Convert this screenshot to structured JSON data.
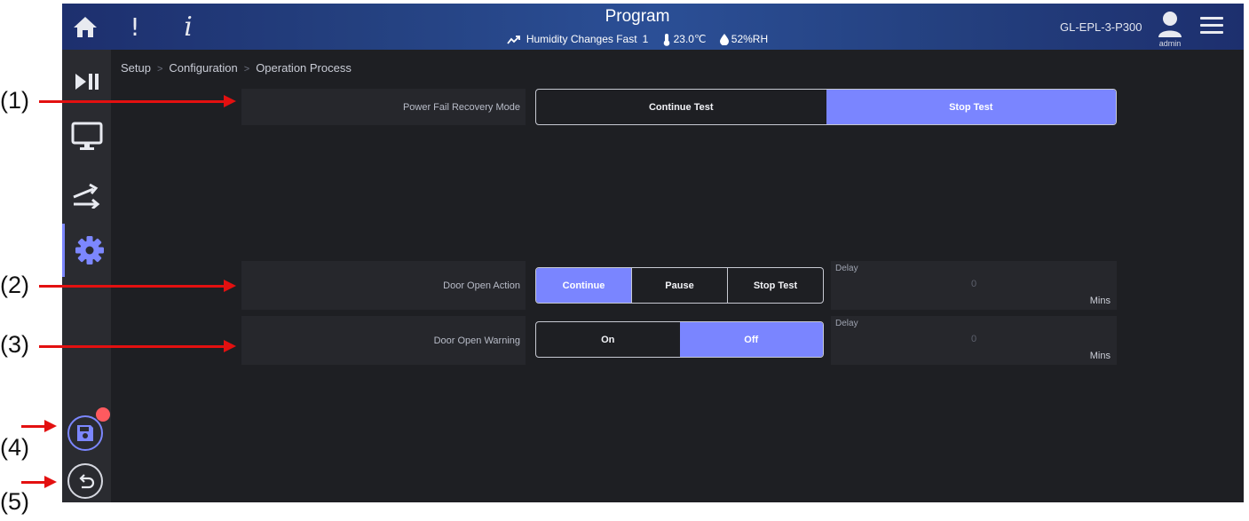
{
  "topbar": {
    "home_icon": "home-icon",
    "alarm_icon": "exclamation-icon",
    "info_icon": "info-icon",
    "title": "Program",
    "status_trend_icon": "trend-up-icon",
    "status_event": "Humidity Changes Fast",
    "status_step": "1",
    "temperature": "23.0℃",
    "humidity": "52%RH",
    "device_name": "GL-EPL-3-P300",
    "user_label": "admin"
  },
  "sidebar": {
    "items": [
      {
        "icon": "play-pause-icon"
      },
      {
        "icon": "monitor-icon"
      },
      {
        "icon": "shuffle-icon"
      },
      {
        "icon": "gear-icon",
        "active": true
      }
    ],
    "save_icon": "save-icon",
    "undo_icon": "undo-icon",
    "unsaved_indicator": true
  },
  "breadcrumb": [
    "Setup",
    "Configuration",
    "Operation Process"
  ],
  "settings": {
    "power_fail": {
      "label": "Power Fail Recovery Mode",
      "options": [
        "Continue Test",
        "Stop Test"
      ],
      "selected": "Stop Test"
    },
    "door_open_action": {
      "label": "Door Open Action",
      "options": [
        "Continue",
        "Pause",
        "Stop Test"
      ],
      "selected": "Continue",
      "delay_label": "Delay",
      "delay_value": "0",
      "delay_unit": "Mins"
    },
    "door_open_warning": {
      "label": "Door Open Warning",
      "options": [
        "On",
        "Off"
      ],
      "selected": "Off",
      "delay_label": "Delay",
      "delay_value": "0",
      "delay_unit": "Mins"
    }
  },
  "annotations": [
    "(1)",
    "(2)",
    "(3)",
    "(4)",
    "(5)"
  ],
  "colors": {
    "accent": "#7a85ff",
    "header_blue": "#2b4f96",
    "background": "#1e1f23",
    "badge_red": "#ff5a5f",
    "arrow_red": "#e31010"
  }
}
